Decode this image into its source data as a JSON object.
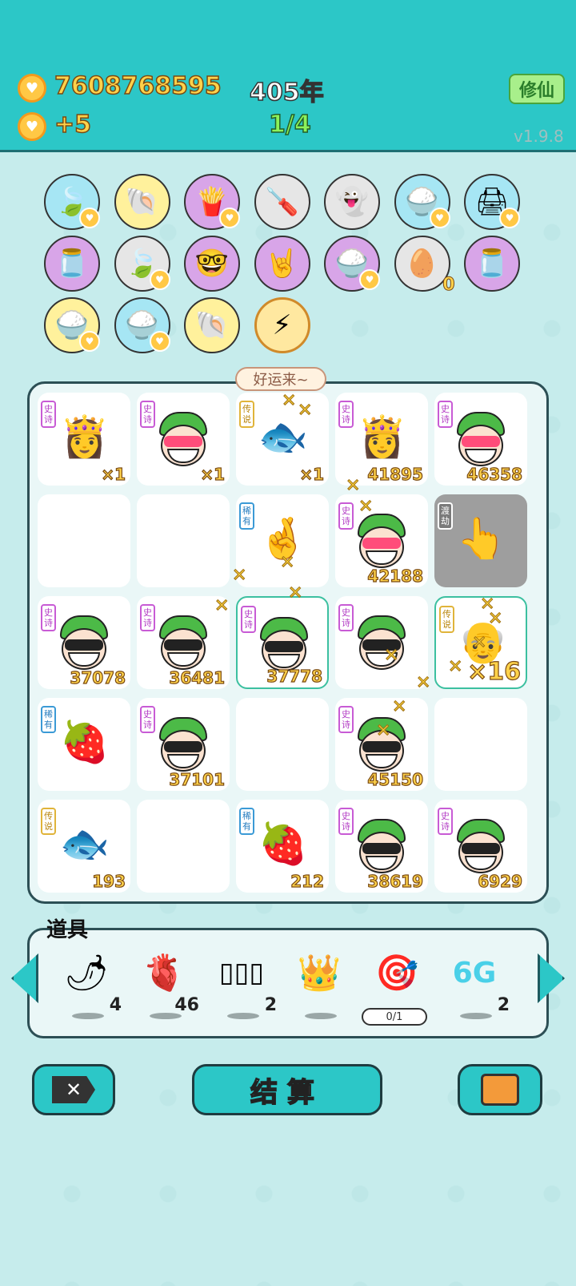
{
  "header": {
    "coins": "7608768595",
    "coin_gain": "+5",
    "year": "405年",
    "progress": "1/4",
    "xiuxian_button": "修仙",
    "version": "v1.9.8"
  },
  "collection_icons": [
    {
      "name": "leaf-icon",
      "glyph": "🍃",
      "bg": "ic-blue",
      "badge": true
    },
    {
      "name": "shell-icon",
      "glyph": "🐚",
      "bg": "ic-yellow",
      "badge": false
    },
    {
      "name": "fries-icon",
      "glyph": "🍟",
      "bg": "ic-purple",
      "badge": true
    },
    {
      "name": "screwdriver-icon",
      "glyph": "🪛",
      "bg": "ic-gray",
      "badge": false
    },
    {
      "name": "ghost-icon",
      "glyph": "👻",
      "bg": "ic-gray",
      "badge": false
    },
    {
      "name": "rice-bowl-icon",
      "glyph": "🍚",
      "bg": "ic-blue",
      "badge": true
    },
    {
      "name": "printer-icon",
      "glyph": "🖨",
      "bg": "ic-blue",
      "badge": true
    },
    {
      "name": "jar-icon",
      "glyph": "🫙",
      "bg": "ic-purple",
      "badge": false
    },
    {
      "name": "leaf-icon",
      "glyph": "🍃",
      "bg": "ic-gray",
      "badge": true
    },
    {
      "name": "multiplier-face-icon",
      "glyph": "🤓",
      "bg": "ic-purple",
      "badge": false
    },
    {
      "name": "rock-hand-icon",
      "glyph": "🤘",
      "bg": "ic-purple",
      "badge": false
    },
    {
      "name": "rice-bowl-icon",
      "glyph": "🍚",
      "bg": "ic-purple",
      "badge": true
    },
    {
      "name": "egg-tray-icon",
      "glyph": "🥚",
      "bg": "ic-gray",
      "badge": false,
      "zero": "0"
    },
    {
      "name": "jar-icon",
      "glyph": "🫙",
      "bg": "ic-purple",
      "badge": false
    },
    {
      "name": "rice-bowl-icon",
      "glyph": "🍚",
      "bg": "ic-yellow",
      "badge": true
    },
    {
      "name": "rice-bowl-icon",
      "glyph": "🍚",
      "bg": "ic-blue",
      "badge": true
    },
    {
      "name": "shell-icon",
      "glyph": "🐚",
      "bg": "ic-yellow",
      "badge": false
    },
    {
      "name": "lightning-icon",
      "glyph": "⚡",
      "bg": "ic-gold",
      "badge": false
    }
  ],
  "luck_bubble": "好运来~",
  "board": [
    {
      "tag": "史诗",
      "tagc": "epic",
      "kind": "pic",
      "glyph": "👸",
      "num": "×1"
    },
    {
      "tag": "史诗",
      "tagc": "epic",
      "kind": "face",
      "glasses": "hearts",
      "num": "×1"
    },
    {
      "tag": "传说",
      "tagc": "legend",
      "kind": "pic",
      "glyph": "🐟",
      "num": "×1"
    },
    {
      "tag": "史诗",
      "tagc": "epic",
      "kind": "pic",
      "glyph": "👸",
      "num": "41895"
    },
    {
      "tag": "史诗",
      "tagc": "epic",
      "kind": "face",
      "glasses": "hearts",
      "num": "46358"
    },
    {
      "tag": "",
      "kind": "empty",
      "num": ""
    },
    {
      "tag": "",
      "kind": "empty",
      "num": ""
    },
    {
      "tag": "稀有",
      "tagc": "rare",
      "kind": "pic",
      "glyph": "🤞",
      "num": ""
    },
    {
      "tag": "史诗",
      "tagc": "epic",
      "kind": "face",
      "glasses": "hearts",
      "num": "42188"
    },
    {
      "tag": "渡劫",
      "tagc": "jie",
      "kind": "pic",
      "glyph": "👆",
      "num": "",
      "dark": true
    },
    {
      "tag": "史诗",
      "tagc": "epic",
      "kind": "face",
      "glasses": "dark",
      "num": "37078"
    },
    {
      "tag": "史诗",
      "tagc": "epic",
      "kind": "face",
      "glasses": "dark",
      "num": "36481"
    },
    {
      "tag": "史诗",
      "tagc": "epic",
      "kind": "face",
      "glasses": "dark",
      "num": "37778",
      "glow": true
    },
    {
      "tag": "史诗",
      "tagc": "epic",
      "kind": "face",
      "glasses": "dark",
      "num": ""
    },
    {
      "tag": "传说",
      "tagc": "legend",
      "kind": "pic",
      "glyph": "👴",
      "num": "×16",
      "glow": true,
      "big": true
    },
    {
      "tag": "稀有",
      "tagc": "rare",
      "kind": "pic",
      "glyph": "🍓",
      "num": ""
    },
    {
      "tag": "史诗",
      "tagc": "epic",
      "kind": "face",
      "glasses": "dark",
      "num": "37101"
    },
    {
      "tag": "",
      "kind": "empty",
      "num": ""
    },
    {
      "tag": "史诗",
      "tagc": "epic",
      "kind": "face",
      "glasses": "dark",
      "num": "45150"
    },
    {
      "tag": "",
      "kind": "empty",
      "num": ""
    },
    {
      "tag": "传说",
      "tagc": "legend",
      "kind": "pic",
      "glyph": "🐟",
      "num": "193"
    },
    {
      "tag": "",
      "kind": "empty",
      "num": ""
    },
    {
      "tag": "稀有",
      "tagc": "rare",
      "kind": "pic",
      "glyph": "🍓",
      "num": "212"
    },
    {
      "tag": "史诗",
      "tagc": "epic",
      "kind": "face",
      "glasses": "dark",
      "num": "38619"
    },
    {
      "tag": "史诗",
      "tagc": "epic",
      "kind": "face",
      "glasses": "dark",
      "num": "6929"
    }
  ],
  "props": {
    "title": "道具",
    "items": [
      {
        "name": "chili-icon",
        "glyph": "🌶",
        "count": "4"
      },
      {
        "name": "liver-icon",
        "glyph": "🫀",
        "count": "46"
      },
      {
        "name": "glass-panels-icon",
        "glyph": "▯▯▯",
        "count": "2"
      },
      {
        "name": "crown-icon",
        "glyph": "👑",
        "count": ""
      },
      {
        "name": "target-icon",
        "glyph": "🎯",
        "count": "",
        "pill": "0/1"
      },
      {
        "name": "sixg-icon",
        "glyph": "6G",
        "count": "2"
      }
    ]
  },
  "buttons": {
    "close_label": "✕",
    "settle_label": "结算"
  }
}
